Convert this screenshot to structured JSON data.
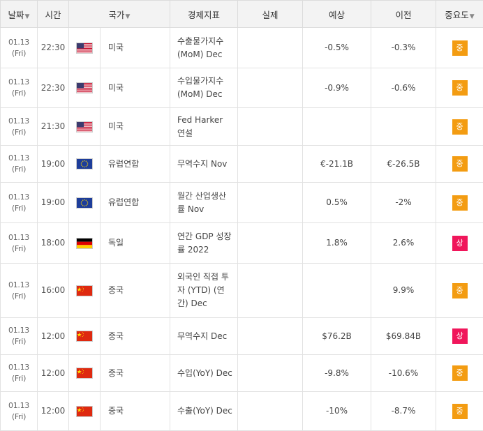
{
  "header": {
    "date": "날짜",
    "time": "시간",
    "country": "국가",
    "indicator": "경제지표",
    "actual": "실제",
    "forecast": "예상",
    "previous": "이전",
    "importance": "중요도",
    "sort_arrow": "▼"
  },
  "colors": {
    "importance_mid": "#f39c12",
    "importance_high": "#f0165b"
  },
  "rows": [
    {
      "date1": "01.13",
      "date2": "(Fri)",
      "time": "22:30",
      "flag": "us-flag-icon",
      "country": "미국",
      "indicator": "수출물가지수(MoM) Dec",
      "actual": "",
      "forecast": "-0.5%",
      "previous": "-0.3%",
      "importance": "중",
      "level": "mid"
    },
    {
      "date1": "01.13",
      "date2": "(Fri)",
      "time": "22:30",
      "flag": "us-flag-icon",
      "country": "미국",
      "indicator": "수입물가지수(MoM) Dec",
      "actual": "",
      "forecast": "-0.9%",
      "previous": "-0.6%",
      "importance": "중",
      "level": "mid"
    },
    {
      "date1": "01.13",
      "date2": "(Fri)",
      "time": "21:30",
      "flag": "us-flag-icon",
      "country": "미국",
      "indicator": "Fed Harker 연설",
      "actual": "",
      "forecast": "",
      "previous": "",
      "importance": "중",
      "level": "mid"
    },
    {
      "date1": "01.13",
      "date2": "(Fri)",
      "time": "19:00",
      "flag": "eu-flag-icon",
      "country": "유럽연합",
      "indicator": "무역수지 Nov",
      "actual": "",
      "forecast": "€-21.1B",
      "previous": "€-26.5B",
      "importance": "중",
      "level": "mid"
    },
    {
      "date1": "01.13",
      "date2": "(Fri)",
      "time": "19:00",
      "flag": "eu-flag-icon",
      "country": "유럽연합",
      "indicator": "월간 산업생산률 Nov",
      "actual": "",
      "forecast": "0.5%",
      "previous": "-2%",
      "importance": "중",
      "level": "mid"
    },
    {
      "date1": "01.13",
      "date2": "(Fri)",
      "time": "18:00",
      "flag": "de-flag-icon",
      "country": "독일",
      "indicator": "연간 GDP 성장률 2022",
      "actual": "",
      "forecast": "1.8%",
      "previous": "2.6%",
      "importance": "상",
      "level": "high"
    },
    {
      "date1": "01.13",
      "date2": "(Fri)",
      "time": "16:00",
      "flag": "cn-flag-icon",
      "country": "중국",
      "indicator": "외국인 직접 투자 (YTD) (연간) Dec",
      "actual": "",
      "forecast": "",
      "previous": "9.9%",
      "importance": "중",
      "level": "mid"
    },
    {
      "date1": "01.13",
      "date2": "(Fri)",
      "time": "12:00",
      "flag": "cn-flag-icon",
      "country": "중국",
      "indicator": "무역수지 Dec",
      "actual": "",
      "forecast": "$76.2B",
      "previous": "$69.84B",
      "importance": "상",
      "level": "high"
    },
    {
      "date1": "01.13",
      "date2": "(Fri)",
      "time": "12:00",
      "flag": "cn-flag-icon",
      "country": "중국",
      "indicator": "수입(YoY) Dec",
      "actual": "",
      "forecast": "-9.8%",
      "previous": "-10.6%",
      "importance": "중",
      "level": "mid"
    },
    {
      "date1": "01.13",
      "date2": "(Fri)",
      "time": "12:00",
      "flag": "cn-flag-icon",
      "country": "중국",
      "indicator": "수출(YoY) Dec",
      "actual": "",
      "forecast": "-10%",
      "previous": "-8.7%",
      "importance": "중",
      "level": "mid"
    }
  ]
}
